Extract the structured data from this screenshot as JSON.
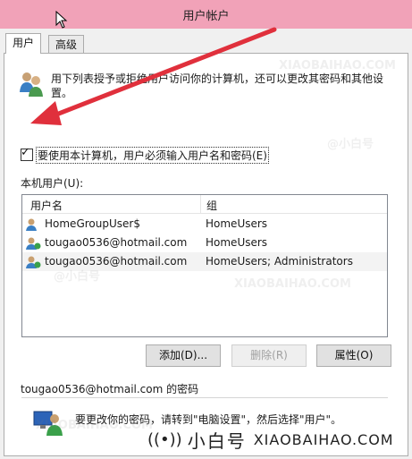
{
  "window": {
    "title": "用户帐户"
  },
  "tabs": [
    {
      "label": "用户",
      "active": true
    },
    {
      "label": "高级",
      "active": false
    }
  ],
  "intro": {
    "text": "用下列表授予或拒绝用户访问你的计算机，还可以更改其密码和其他设置。"
  },
  "require_password": {
    "label": "要使用本计算机，用户必须输入用户名和密码(E)",
    "checked": true
  },
  "users_list": {
    "label": "本机用户(U):",
    "columns": [
      "用户名",
      "组"
    ],
    "rows": [
      {
        "name": "HomeGroupUser$",
        "group": "HomeUsers",
        "icon": "user-icon"
      },
      {
        "name": "tougao0536@hotmail.com",
        "group": "HomeUsers",
        "icon": "user-online-icon"
      },
      {
        "name": "tougao0536@hotmail.com",
        "group": "HomeUsers; Administrators",
        "icon": "user-online-icon"
      }
    ]
  },
  "buttons": {
    "add": "添加(D)...",
    "remove": "删除(R)",
    "properties": "属性(O)"
  },
  "password_section": {
    "title": "tougao0536@hotmail.com 的密码",
    "text": "要更改你的密码，请转到\"电脑设置\"，然后选择\"用户\"。"
  },
  "watermark": {
    "brand_cn": "小白号",
    "brand_en": "XIAOBAIHAO.COM",
    "tile_cn": "@小白号",
    "tile_en": "XIAOBAIHAO.COM"
  },
  "colors": {
    "title_bar": "#f1a2b8",
    "arrow": "#e0303c",
    "selection": "#f3f3f3"
  }
}
